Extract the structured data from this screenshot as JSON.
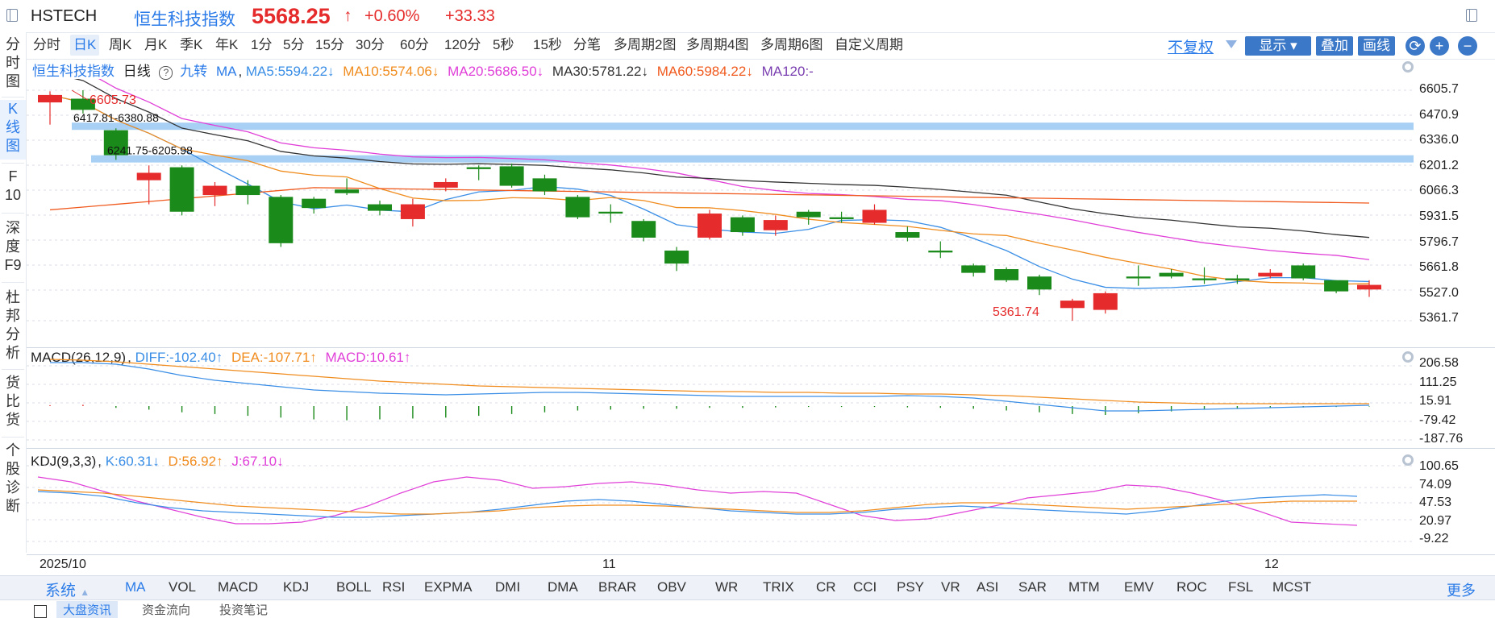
{
  "header": {
    "code": "HSTECH",
    "index_name": "恒生科技指数",
    "price": "5568.25",
    "price_arrow": "↑",
    "change_pct": "+0.60%",
    "change_abs": "+33.33",
    "up_color": "#e52b2b",
    "down_color": "#1a8a1a"
  },
  "left_nav": [
    {
      "label": "分\n时\n图",
      "active": false
    },
    {
      "label": "K\n线\n图",
      "active": true
    },
    {
      "label": "F\n10",
      "active": false
    },
    {
      "label": "深\n度\nF9",
      "active": false
    },
    {
      "label": "杜\n邦\n分\n析",
      "active": false
    },
    {
      "label": "货\n比\n货",
      "active": false
    },
    {
      "label": "个\n股\n诊\n断",
      "active": false
    }
  ],
  "periods": [
    "分时",
    "日K",
    "周K",
    "月K",
    "季K",
    "年K",
    "1分",
    "5分",
    "15分",
    "30分",
    "60分",
    "120分",
    "5秒",
    "15秒",
    "分笔",
    "多周期2图",
    "多周期4图",
    "多周期6图",
    "自定义周期"
  ],
  "active_period": "日K",
  "toolbar": {
    "adjust": "不复权",
    "display": "显示",
    "overlay": "叠加",
    "draw": "画线",
    "refresh_icon": "⟳",
    "zoom_in_icon": "+",
    "zoom_out_icon": "−"
  },
  "main_legend": {
    "name": "恒生科技指数",
    "period": "日线",
    "help_icon": "?",
    "nine": "九转",
    "ma": "MA",
    "ma5": "MA5:5594.22↓",
    "ma10": "MA10:5574.06↓",
    "ma20": "MA20:5686.50↓",
    "ma30": "MA30:5781.22↓",
    "ma60": "MA60:5984.22↓",
    "ma120": "MA120:-"
  },
  "ma_colors": {
    "ma5": "#3a8ee6",
    "ma10": "#f08c1e",
    "ma20": "#e03fd8",
    "ma30": "#333333",
    "ma60": "#f05a1e",
    "ma120": "#7a3fb0"
  },
  "main_axis": [
    "6605.7",
    "6470.9",
    "6336.0",
    "6201.2",
    "6066.3",
    "5931.5",
    "5796.7",
    "5661.8",
    "5527.0",
    "5361.7"
  ],
  "annotations": {
    "high": "6605.73",
    "low": "5361.74",
    "band1": "6417.81-6380.88",
    "band2": "6241.75-6205.98"
  },
  "macd": {
    "title": "MACD(26,12,9)",
    "diff": "DIFF:-102.40↑",
    "dea": "DEA:-107.71↑",
    "macd": "MACD:10.61↑",
    "axis": [
      "206.58",
      "111.25",
      "15.91",
      "-79.42",
      "-187.76"
    ]
  },
  "kdj": {
    "title": "KDJ(9,3,3)",
    "k": "K:60.31↓",
    "d": "D:56.92↑",
    "j": "J:67.10↓",
    "axis": [
      "100.65",
      "74.09",
      "47.53",
      "20.97",
      "-9.22"
    ]
  },
  "time_axis": [
    "2025/10",
    "11",
    "12"
  ],
  "indicator_tabs": [
    "MA",
    "VOL",
    "MACD",
    "KDJ",
    "BOLL",
    "RSI",
    "EXPMA",
    "DMI",
    "DMA",
    "BRAR",
    "OBV",
    "WR",
    "TRIX",
    "CR",
    "CCI",
    "PSY",
    "VR",
    "ASI",
    "SAR",
    "MTM",
    "EMV",
    "ROC",
    "FSL",
    "MCST"
  ],
  "indicator_active": "MA",
  "system_label": "系统",
  "more_label": "更多",
  "bottom_tabs": [
    "大盘资讯",
    "资金流向",
    "投资笔记"
  ],
  "chart_data": {
    "type": "candlestick",
    "y_axis_range": [
      5361.7,
      6605.7
    ],
    "high_marker": 6605.73,
    "low_marker": 5361.74,
    "price_bands": [
      [
        6417.81,
        6380.88
      ],
      [
        6241.75,
        6205.98
      ]
    ],
    "candles": [
      {
        "o": 6540,
        "c": 6580,
        "h": 6600,
        "l": 6420
      },
      {
        "o": 6560,
        "c": 6500,
        "h": 6605.7,
        "l": 6480
      },
      {
        "o": 6390,
        "c": 6255,
        "h": 6400,
        "l": 6230
      },
      {
        "o": 6120,
        "c": 6160,
        "h": 6200,
        "l": 5990
      },
      {
        "o": 6190,
        "c": 5950,
        "h": 6200,
        "l": 5930
      },
      {
        "o": 6040,
        "c": 6090,
        "h": 6110,
        "l": 5980
      },
      {
        "o": 6090,
        "c": 6040,
        "h": 6120,
        "l": 5990
      },
      {
        "o": 6030,
        "c": 5780,
        "h": 6040,
        "l": 5760
      },
      {
        "o": 6020,
        "c": 5970,
        "h": 6030,
        "l": 5940
      },
      {
        "o": 6070,
        "c": 6050,
        "h": 6130,
        "l": 6040
      },
      {
        "o": 5990,
        "c": 5955,
        "h": 6010,
        "l": 5930
      },
      {
        "o": 5910,
        "c": 5990,
        "h": 6020,
        "l": 5870
      },
      {
        "o": 6080,
        "c": 6110,
        "h": 6130,
        "l": 6060
      },
      {
        "o": 6190,
        "c": 6180,
        "h": 6200,
        "l": 6120
      },
      {
        "o": 6195,
        "c": 6090,
        "h": 6210,
        "l": 6080
      },
      {
        "o": 6130,
        "c": 6060,
        "h": 6150,
        "l": 6040
      },
      {
        "o": 6030,
        "c": 5920,
        "h": 6040,
        "l": 5910
      },
      {
        "o": 5950,
        "c": 5940,
        "h": 5990,
        "l": 5890
      },
      {
        "o": 5900,
        "c": 5810,
        "h": 5910,
        "l": 5790
      },
      {
        "o": 5740,
        "c": 5670,
        "h": 5760,
        "l": 5630
      },
      {
        "o": 5810,
        "c": 5940,
        "h": 5960,
        "l": 5800
      },
      {
        "o": 5920,
        "c": 5840,
        "h": 5930,
        "l": 5820
      },
      {
        "o": 5850,
        "c": 5905,
        "h": 5930,
        "l": 5820
      },
      {
        "o": 5950,
        "c": 5920,
        "h": 5960,
        "l": 5880
      },
      {
        "o": 5920,
        "c": 5910,
        "h": 5950,
        "l": 5890
      },
      {
        "o": 5890,
        "c": 5960,
        "h": 5990,
        "l": 5880
      },
      {
        "o": 5840,
        "c": 5810,
        "h": 5870,
        "l": 5790
      },
      {
        "o": 5740,
        "c": 5730,
        "h": 5790,
        "l": 5700
      },
      {
        "o": 5660,
        "c": 5620,
        "h": 5670,
        "l": 5600
      },
      {
        "o": 5640,
        "c": 5580,
        "h": 5650,
        "l": 5570
      },
      {
        "o": 5600,
        "c": 5530,
        "h": 5610,
        "l": 5500
      },
      {
        "o": 5430,
        "c": 5470,
        "h": 5480,
        "l": 5361.74
      },
      {
        "o": 5420,
        "c": 5510,
        "h": 5520,
        "l": 5400
      },
      {
        "o": 5600,
        "c": 5590,
        "h": 5660,
        "l": 5550
      },
      {
        "o": 5620,
        "c": 5600,
        "h": 5640,
        "l": 5590
      },
      {
        "o": 5590,
        "c": 5580,
        "h": 5650,
        "l": 5560
      },
      {
        "o": 5590,
        "c": 5580,
        "h": 5610,
        "l": 5560
      },
      {
        "o": 5600,
        "c": 5620,
        "h": 5640,
        "l": 5590
      },
      {
        "o": 5660,
        "c": 5590,
        "h": 5670,
        "l": 5580
      },
      {
        "o": 5580,
        "c": 5520,
        "h": 5580,
        "l": 5510
      },
      {
        "o": 5530,
        "c": 5555,
        "h": 5580,
        "l": 5490
      }
    ]
  }
}
